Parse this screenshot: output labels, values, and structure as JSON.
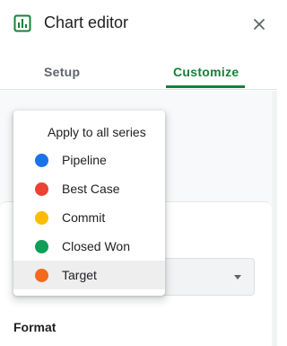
{
  "header": {
    "title": "Chart editor",
    "app_icon": "chart-icon",
    "close_icon": "close-icon"
  },
  "tabs": [
    {
      "label": "Setup",
      "active": false
    },
    {
      "label": "Customize",
      "active": true
    }
  ],
  "menu": {
    "header": "Apply to all series",
    "items": [
      {
        "label": "Pipeline",
        "color": "#1a73e8",
        "selected": false
      },
      {
        "label": "Best Case",
        "color": "#ea4335",
        "selected": false
      },
      {
        "label": "Commit",
        "color": "#fbbc04",
        "selected": false
      },
      {
        "label": "Closed Won",
        "color": "#0f9d58",
        "selected": false
      },
      {
        "label": "Target",
        "color": "#f36a1d",
        "selected": true
      }
    ]
  },
  "section": {
    "format_label": "Format"
  },
  "colors": {
    "accent": "#188038",
    "tab_inactive": "#5f6368"
  }
}
